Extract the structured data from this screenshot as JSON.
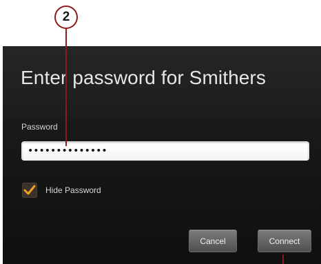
{
  "callout": {
    "number": "2"
  },
  "dialog": {
    "title": "Enter password for Smithers",
    "password_label": "Password",
    "password_value": "••••••••••••••",
    "hide_password_label": "Hide Password",
    "hide_password_checked": true,
    "cancel_label": "Cancel",
    "connect_label": "Connect"
  },
  "colors": {
    "callout_red": "#8c1a1a",
    "checkmark_orange": "#f0a020",
    "dialog_background": "#161616"
  },
  "icons": {
    "checkbox": "checkmark-icon"
  }
}
